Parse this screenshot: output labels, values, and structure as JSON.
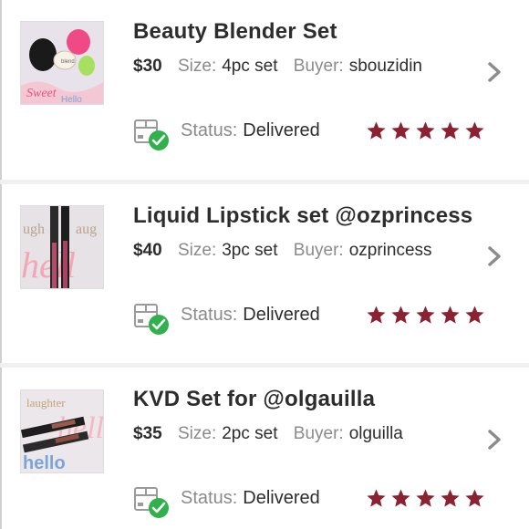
{
  "orders": [
    {
      "title": "Beauty Blender Set",
      "price": "$30",
      "size_label": "Size:",
      "size": "4pc set",
      "buyer_label": "Buyer:",
      "buyer": "sbouzidin",
      "status_label": "Status:",
      "status": "Delivered",
      "rating": 5,
      "thumb_icon": "beauty-blender-thumbnail"
    },
    {
      "title": "Liquid Lipstick set @ozprincess",
      "price": "$40",
      "size_label": "Size:",
      "size": "3pc set",
      "buyer_label": "Buyer:",
      "buyer": "ozprincess",
      "status_label": "Status:",
      "status": "Delivered",
      "rating": 5,
      "thumb_icon": "liquid-lipstick-thumbnail"
    },
    {
      "title": "KVD Set for @olgauilla",
      "price": "$35",
      "size_label": "Size:",
      "size": "2pc set",
      "buyer_label": "Buyer:",
      "buyer": "olguilla",
      "status_label": "Status:",
      "status": "Delivered",
      "rating": 5,
      "thumb_icon": "kvd-set-thumbnail"
    }
  ],
  "colors": {
    "star": "#8b2232",
    "check": "#2fb24c",
    "chevron": "#8c8c8c",
    "text_dark": "#2d2d2d",
    "text_muted": "#8a8a8a"
  },
  "icons": {
    "chevron": "chevron-right-icon",
    "status": "delivered-box-icon",
    "star": "star-icon"
  }
}
